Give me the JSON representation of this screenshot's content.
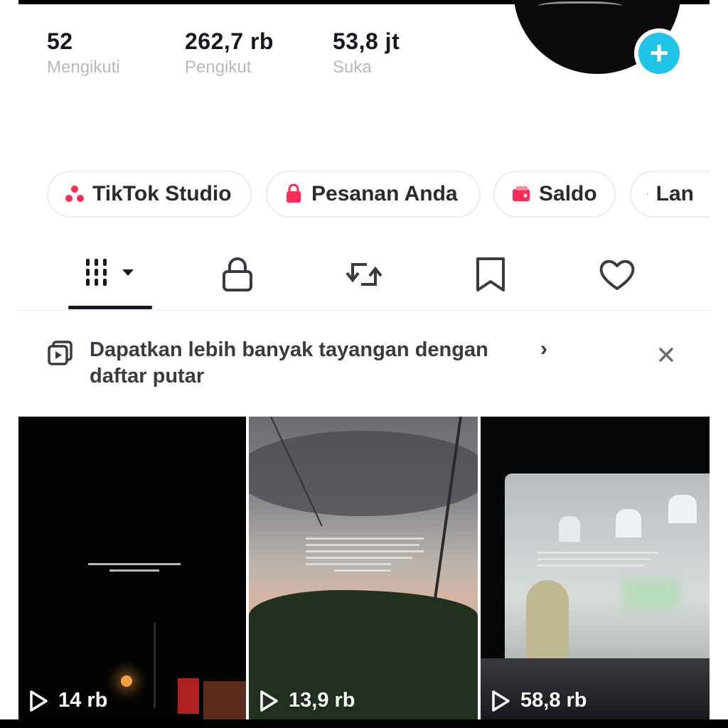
{
  "stats": [
    {
      "value": "52",
      "label": "Mengikuti"
    },
    {
      "value": "262,7 rb",
      "label": "Pengikut"
    },
    {
      "value": "53,8 jt",
      "label": "Suka"
    }
  ],
  "add_badge_symbol": "+",
  "chips": [
    {
      "label": "TikTok Studio",
      "icon": "tiktok-studio-icon"
    },
    {
      "label": "Pesanan Anda",
      "icon": "shopping-bag-icon"
    },
    {
      "label": "Saldo",
      "icon": "wallet-icon"
    },
    {
      "label": "Lan",
      "icon": "promote-icon"
    }
  ],
  "tabs": [
    {
      "name": "videos-grid",
      "icon": "grid-icon",
      "active": true
    },
    {
      "name": "private",
      "icon": "lock-icon"
    },
    {
      "name": "reposts",
      "icon": "repost-icon"
    },
    {
      "name": "favorites",
      "icon": "bookmark-icon"
    },
    {
      "name": "liked",
      "icon": "heart-icon"
    }
  ],
  "banner": {
    "text": "Dapatkan lebih banyak tayangan dengan daftar putar",
    "chevron": "›",
    "close": "×"
  },
  "videos": [
    {
      "views": "14 rb"
    },
    {
      "views": "13,9 rb"
    },
    {
      "views": "58,8 rb"
    }
  ],
  "colors": {
    "accent": "#20c4e6",
    "chip_icon": "#fe2c55",
    "text_dark": "#161823",
    "text_muted": "#b8b9be"
  }
}
